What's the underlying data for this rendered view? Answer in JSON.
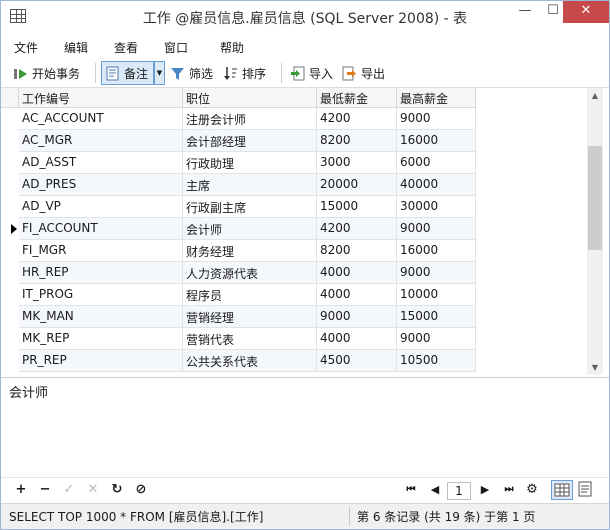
{
  "window": {
    "title": "工作 @雇员信息.雇员信息 (SQL Server 2008) - 表",
    "min": "—",
    "max": "☐",
    "close": "✕"
  },
  "menu": [
    "文件",
    "编辑",
    "查看",
    "窗口",
    "帮助"
  ],
  "toolbar": {
    "begin_transaction": "开始事务",
    "memo": "备注",
    "filter": "筛选",
    "sort": "排序",
    "import": "导入",
    "export": "导出"
  },
  "grid": {
    "columns": [
      "工作编号",
      "职位",
      "最低薪金",
      "最高薪金"
    ],
    "rows": [
      [
        "AC_ACCOUNT",
        "注册会计师",
        "4200",
        "9000"
      ],
      [
        "AC_MGR",
        "会计部经理",
        "8200",
        "16000"
      ],
      [
        "AD_ASST",
        "行政助理",
        "3000",
        "6000"
      ],
      [
        "AD_PRES",
        "主席",
        "20000",
        "40000"
      ],
      [
        "AD_VP",
        "行政副主席",
        "15000",
        "30000"
      ],
      [
        "FI_ACCOUNT",
        "会计师",
        "4200",
        "9000"
      ],
      [
        "FI_MGR",
        "财务经理",
        "8200",
        "16000"
      ],
      [
        "HR_REP",
        "人力资源代表",
        "4000",
        "9000"
      ],
      [
        "IT_PROG",
        "程序员",
        "4000",
        "10000"
      ],
      [
        "MK_MAN",
        "营销经理",
        "9000",
        "15000"
      ],
      [
        "MK_REP",
        "营销代表",
        "4000",
        "9000"
      ],
      [
        "PR_REP",
        "公共关系代表",
        "4500",
        "10500"
      ]
    ],
    "current_row": 5
  },
  "memo": {
    "text": "会计师"
  },
  "nav": {
    "page": "1"
  },
  "status": {
    "sql": "SELECT TOP 1000  * FROM [雇员信息].[工作]",
    "record": "第 6 条记录 (共 19 条) 于第 1 页"
  },
  "colors": {
    "accent": "#6a9fd3",
    "close": "#c74a4a",
    "selected_bg": "#dbe9f8"
  }
}
